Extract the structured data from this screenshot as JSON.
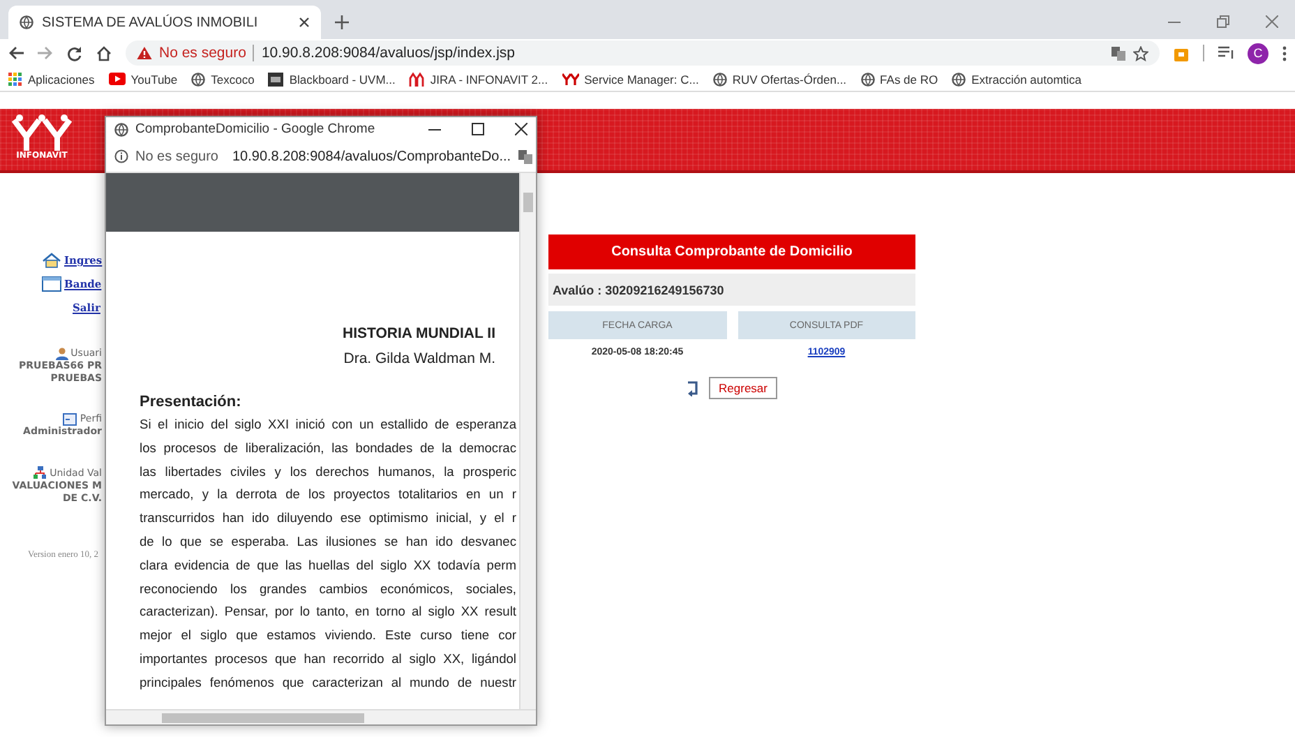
{
  "browser": {
    "tab": {
      "title": "SISTEMA DE AVALÚOS INMOBILI",
      "selected": true
    },
    "address": {
      "security": "No es seguro",
      "url": "10.90.8.208:9084/avaluos/jsp/index.jsp"
    },
    "profile_initial": "C",
    "bookmarks": [
      {
        "label": "Aplicaciones",
        "kind": "apps"
      },
      {
        "label": "YouTube",
        "kind": "youtube"
      },
      {
        "label": "Texcoco",
        "kind": "globe"
      },
      {
        "label": "Blackboard - UVM...",
        "kind": "bb"
      },
      {
        "label": "JIRA - INFONAVIT 2...",
        "kind": "figures"
      },
      {
        "label": "Service Manager: C...",
        "kind": "sm"
      },
      {
        "label": "RUV Ofertas-Órden...",
        "kind": "globe"
      },
      {
        "label": "FAs de RO",
        "kind": "globe"
      },
      {
        "label": "Extracción automtica",
        "kind": "globe"
      }
    ]
  },
  "header": {
    "logo_text": "INFONAVIT"
  },
  "sidebar": {
    "links": [
      {
        "label": "Ingres",
        "kind": "home"
      },
      {
        "label": "Bande",
        "kind": "window"
      },
      {
        "label": "Salir",
        "kind": "none"
      }
    ],
    "info": [
      {
        "kind": "user",
        "label": "Usuari",
        "lines": [
          "PRUEBAS66 PR",
          "PRUEBAS"
        ]
      },
      {
        "kind": "profile",
        "label": "Perfi",
        "lines": [
          "Administrador"
        ]
      },
      {
        "kind": "unit",
        "label": "Unidad Val",
        "lines": [
          "VALUACIONES M",
          "DE C.V."
        ]
      }
    ],
    "version": "Version enero 10, 2"
  },
  "consulta": {
    "title": "Consulta Comprobante de Domicilio",
    "avaluo": "Avalúo : 30209216249156730",
    "columns": [
      "FECHA CARGA",
      "CONSULTA PDF"
    ],
    "rows": [
      [
        "2020-05-08 18:20:45",
        "1102909"
      ]
    ],
    "button": "Regresar"
  },
  "popup": {
    "title": "ComprobanteDomicilio - Google Chrome",
    "security": "No es seguro",
    "url": "10.90.8.208:9084/avaluos/ComprobanteDo...",
    "document": {
      "title": "HISTORIA MUNDIAL II",
      "author": "Dra. Gilda Waldman M.",
      "heading": "Presentación:",
      "lines": [
        "Si el inicio del siglo XXI inició con un estallido de esperanza",
        "los procesos de liberalización, las bondades de la democrac",
        "las libertades civiles y los derechos humanos, la prosperic",
        "mercado, y la derrota de los proyectos totalitarios en un r",
        "transcurridos han ido diluyendo ese optimismo inicial, y el r",
        "de lo que se esperaba. Las ilusiones se han ido desvanec",
        "clara evidencia de que las huellas del siglo XX todavía perm",
        "reconociendo los grandes cambios económicos, sociales,",
        "caracterizan). Pensar, por lo tanto, en torno al siglo XX result",
        "mejor el siglo que estamos viviendo. Este curso tiene cor",
        "importantes procesos que han recorrido al siglo XX, ligándol",
        "principales fenómenos que caracterizan al mundo de nuestr"
      ]
    }
  }
}
